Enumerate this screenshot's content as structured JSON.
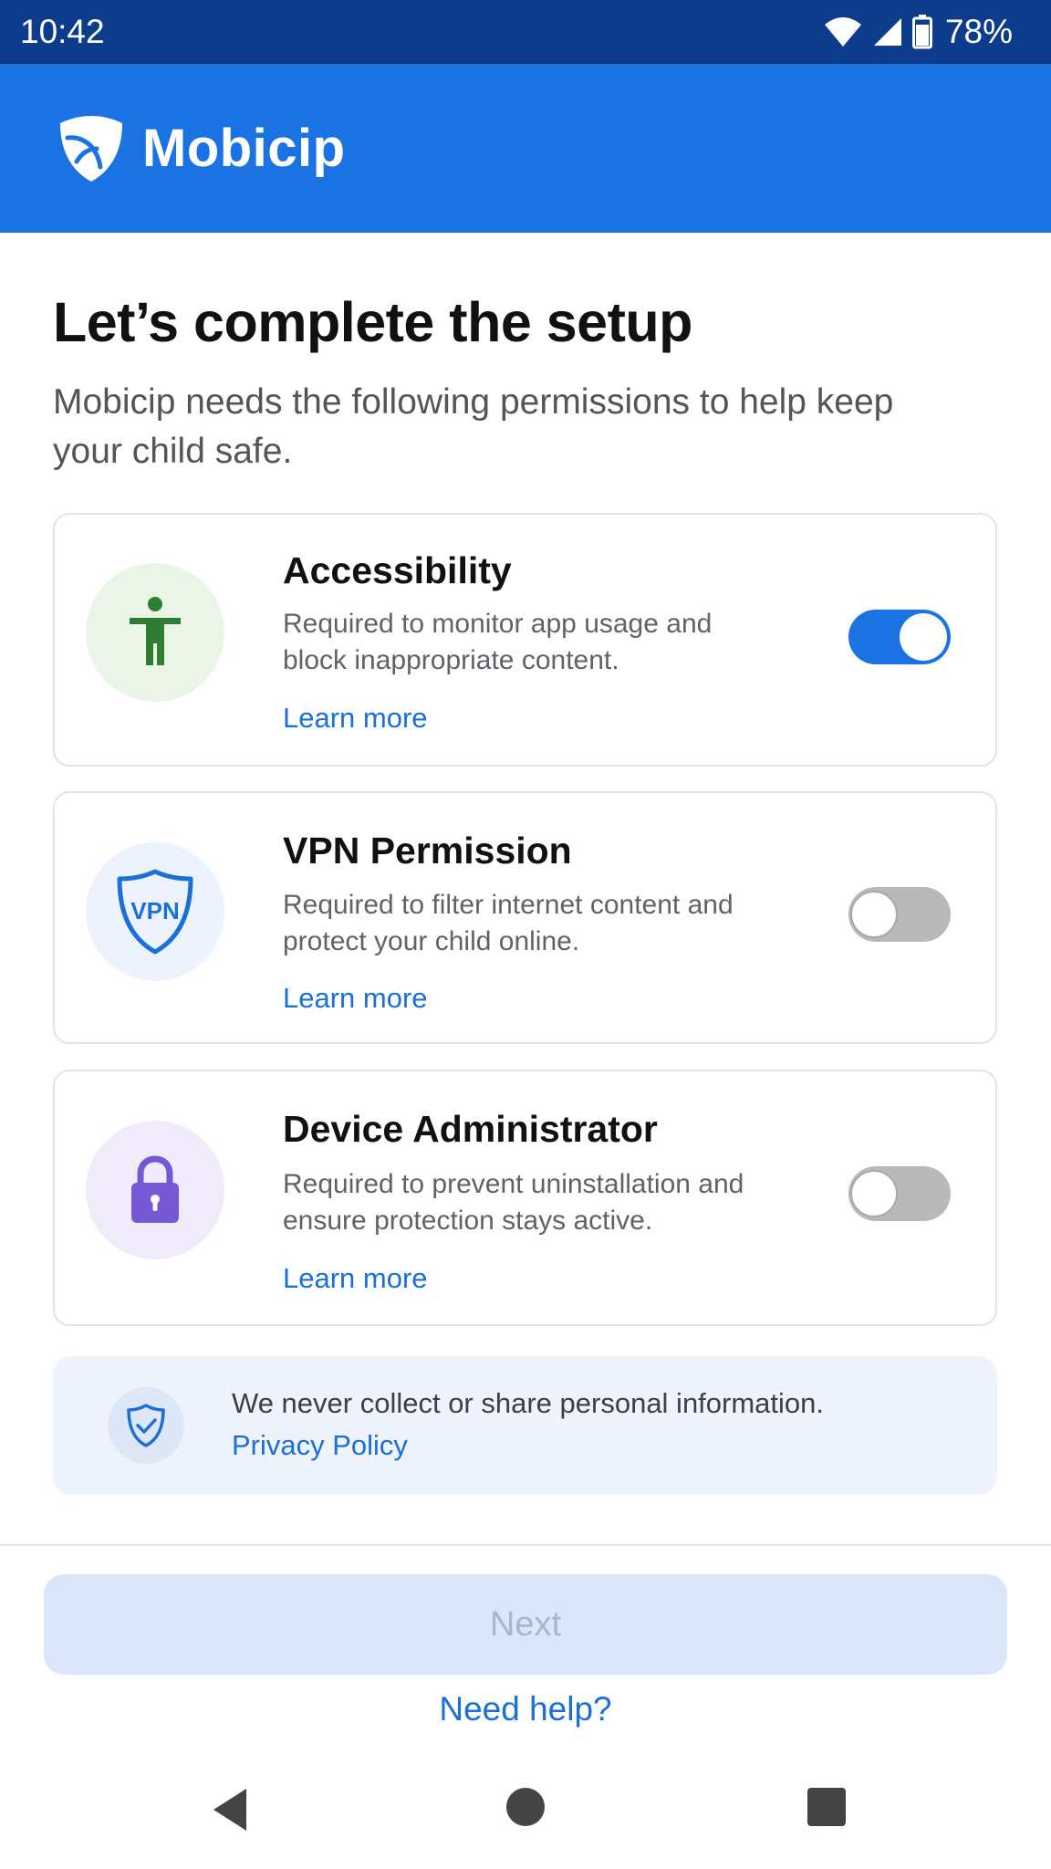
{
  "status_bar": {
    "time": "10:42",
    "battery": "78%",
    "icons": [
      "wifi-icon",
      "cellular-signal-icon",
      "battery-icon"
    ]
  },
  "app_bar": {
    "brand_name": "Mobicip",
    "logo_icon": "mobicip-shield-logo",
    "background_color": "#1b73e3"
  },
  "header": {
    "title": "Let’s complete the setup",
    "subtitle": "Mobicip needs the following permissions to help keep your child safe."
  },
  "permissions": [
    {
      "title": "Accessibility",
      "description": "Required to monitor app usage and block inappropriate content.",
      "link": "Learn more",
      "icon": "accessibility-person-icon",
      "enabled": true
    },
    {
      "title": "VPN Permission",
      "description": "Required to filter internet content and protect your child online.",
      "link": "Learn more",
      "icon": "vpn-shield-icon",
      "icon_text": "VPN",
      "enabled": false
    },
    {
      "title": "Device Administrator",
      "description": "Required to prevent uninstallation and ensure protection stays active.",
      "link": "Learn more",
      "icon": "padlock-icon",
      "enabled": false
    }
  ],
  "privacy": {
    "text": "We never collect or share personal information.",
    "link": "Privacy Policy",
    "icon": "shield-check-icon"
  },
  "footer": {
    "next_label": "Next",
    "next_disabled": true,
    "help_label": "Need help?"
  },
  "nav_bar": {
    "buttons": [
      "back-icon",
      "home-icon",
      "recents-icon"
    ]
  },
  "colors": {
    "accent": "#1b73e3",
    "status_bar": "#0d3c8c",
    "link": "#1a6fd8",
    "accessibility_green": "#2e7d32",
    "device_admin_purple": "#7658d4"
  }
}
